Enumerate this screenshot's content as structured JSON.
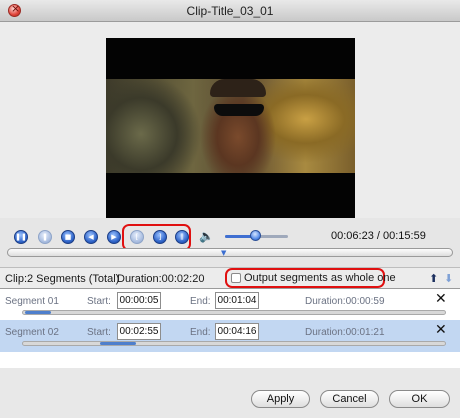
{
  "window": {
    "title": "Clip-Title_03_01"
  },
  "player": {
    "time_current": "00:06:23",
    "time_separator": "/",
    "time_total": "00:15:59",
    "volume_level": 0.5,
    "buttons": [
      "pause-icon",
      "step-icon",
      "stop-icon",
      "prev-icon",
      "next-icon",
      "mark-in-icon",
      "mark-out-icon",
      "split-icon",
      "speaker-icon"
    ]
  },
  "segments": {
    "title": "Clip:2 Segments (Total)",
    "duration_label": "Duration:",
    "duration": "00:02:20",
    "output_whole_label": "Output segments as whole one",
    "output_whole_checked": false,
    "start_label": "Start:",
    "end_label": "End:",
    "row_duration_label": "Duration:",
    "items": [
      {
        "name": "Segment 01",
        "start": "00:00:05",
        "end": "00:01:04",
        "duration": "00:00:59",
        "selected": false,
        "range_fraction": [
          0.005,
          0.067
        ]
      },
      {
        "name": "Segment 02",
        "start": "00:02:55",
        "end": "00:04:16",
        "duration": "00:01:21",
        "selected": true,
        "range_fraction": [
          0.183,
          0.267
        ]
      }
    ]
  },
  "footer": {
    "apply": "Apply",
    "cancel": "Cancel",
    "ok": "OK"
  },
  "colors": {
    "highlight": "#e01010",
    "accent": "#2e63c8",
    "selected_row": "#c2d7f2"
  }
}
